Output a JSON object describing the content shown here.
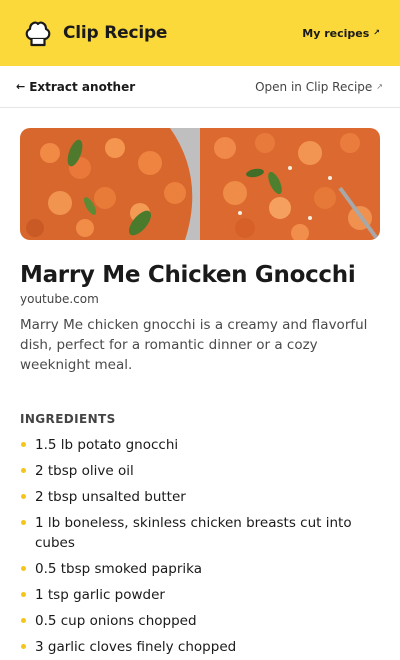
{
  "header": {
    "brand_name": "Clip Recipe",
    "my_recipes_label": "My recipes",
    "accent_color": "#fcd93a"
  },
  "subbar": {
    "back_label": "Extract another",
    "open_label": "Open in Clip Recipe"
  },
  "recipe": {
    "title": "Marry Me Chicken Gnocchi",
    "source": "youtube.com",
    "description": "Marry Me chicken gnocchi is a creamy and flavorful dish, perfect for a romantic dinner or a cozy weeknight meal.",
    "ingredients_label": "INGREDIENTS",
    "ingredients": [
      "1.5 lb potato gnocchi",
      "2 tbsp olive oil",
      "2 tbsp unsalted butter",
      "1 lb boneless, skinless chicken breasts cut into cubes",
      "0.5 tbsp smoked paprika",
      "1 tsp garlic powder",
      "0.5 cup onions chopped",
      "3 garlic cloves finely chopped"
    ]
  },
  "icons": {
    "logo": "chef-hat-icon",
    "external": "external-arrow-icon",
    "back": "left-arrow-icon",
    "bullet_color": "#f5c518"
  }
}
